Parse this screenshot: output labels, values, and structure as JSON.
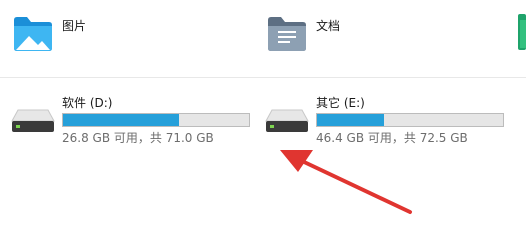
{
  "folders": [
    {
      "label": "图片",
      "icon": "pictures-folder-icon"
    },
    {
      "label": "文档",
      "icon": "documents-folder-icon"
    }
  ],
  "drives": [
    {
      "label": "软件 (D:)",
      "icon": "hard-drive-icon",
      "free_space": "26.8 GB 可用",
      "total_space": "共 71.0 GB",
      "info": "26.8 GB 可用，共 71.0 GB",
      "used_fraction": 0.623
    },
    {
      "label": "其它 (E:)",
      "icon": "hard-drive-icon",
      "free_space": "46.4 GB 可用",
      "total_space": "共 72.5 GB",
      "info": "46.4 GB 可用，共 72.5 GB",
      "used_fraction": 0.36
    }
  ],
  "colors": {
    "usage_bar_fill": "#26a0da",
    "usage_bar_track": "#e6e6e6",
    "annotation_arrow": "#e03530"
  }
}
